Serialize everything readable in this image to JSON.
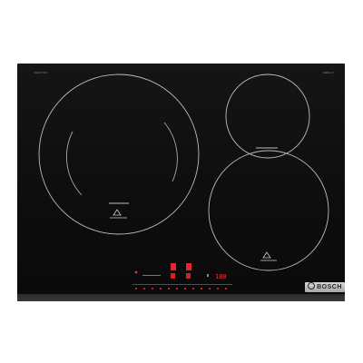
{
  "appliance": {
    "brand": "BOSCH",
    "type": "induction hob",
    "surface_color": "#111111",
    "frame_color": "#333333",
    "accent_red": "#ff2a2a"
  },
  "labels": {
    "top_left_small": "INDUCTION",
    "top_left_sub": "",
    "top_right_small": "SERIE | 6",
    "top_right_sub": ""
  },
  "controls": {
    "display_power_left": "8",
    "display_power_mid": "0",
    "display_timer": "180",
    "display_small": "9",
    "control_count": 17
  },
  "icons": {
    "zone_marker": "pan-symbol-icon",
    "brand_logo": "bosch-logo-icon"
  }
}
